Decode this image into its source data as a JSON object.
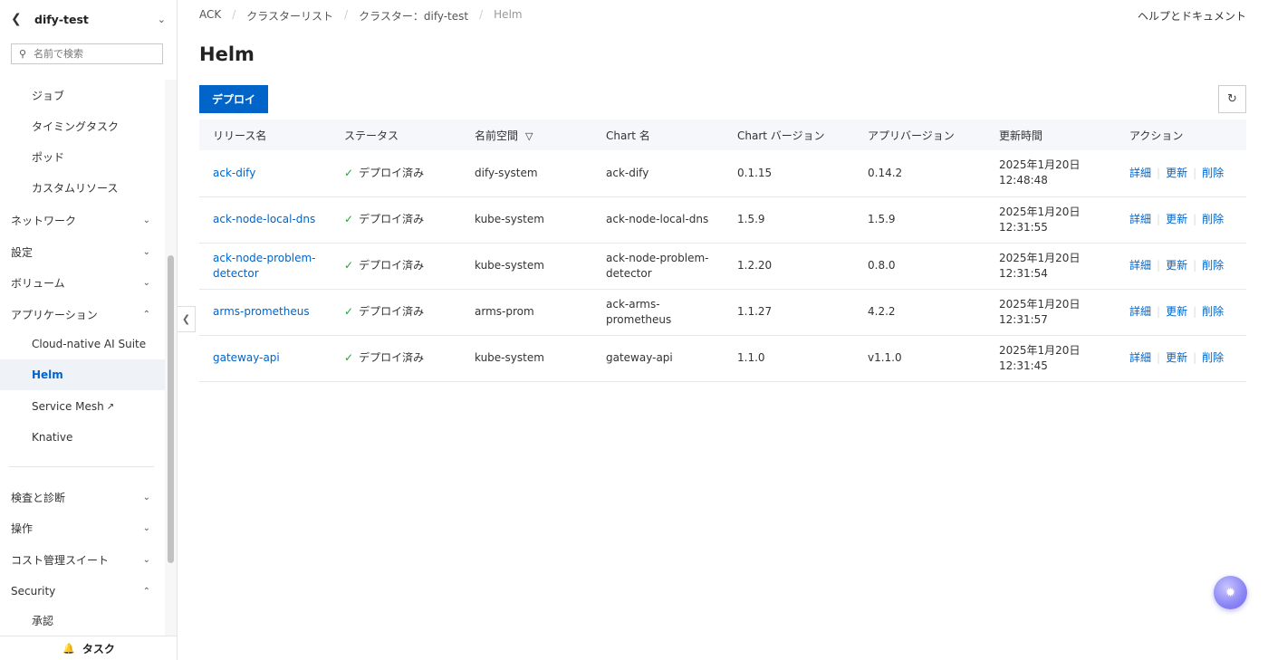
{
  "sidebar": {
    "title": "dify-test",
    "search_placeholder": "名前で検索",
    "items": [
      {
        "label": "ジョブ"
      },
      {
        "label": "タイミングタスク"
      },
      {
        "label": "ポッド"
      },
      {
        "label": "カスタムリソース"
      },
      {
        "label": "ネットワーク"
      },
      {
        "label": "設定"
      },
      {
        "label": "ボリューム"
      },
      {
        "label": "アプリケーション"
      },
      {
        "label": "Cloud-native AI Suite"
      },
      {
        "label": "Helm"
      },
      {
        "label": "Service Mesh"
      },
      {
        "label": "Knative"
      },
      {
        "label": "検査と診断"
      },
      {
        "label": "操作"
      },
      {
        "label": "コスト管理スイート"
      },
      {
        "label": "Security"
      },
      {
        "label": "承認"
      }
    ],
    "footer_label": "タスク"
  },
  "breadcrumb": [
    "ACK",
    "クラスターリスト",
    "クラスター：dify-test",
    "Helm"
  ],
  "help_link": "ヘルプとドキュメント",
  "page_title": "Helm",
  "deploy_button": "デプロイ",
  "table": {
    "columns": [
      "リリース名",
      "ステータス",
      "名前空間",
      "Chart 名",
      "Chart バージョン",
      "アプリバージョン",
      "更新時間",
      "アクション"
    ],
    "rows": [
      {
        "name": "ack-dify",
        "status": "デプロイ済み",
        "namespace": "dify-system",
        "chart": "ack-dify",
        "chart_version": "0.1.15",
        "app_version": "0.14.2",
        "updated_date": "2025年1月20日",
        "updated_time": "12:48:48"
      },
      {
        "name": "ack-node-local-dns",
        "status": "デプロイ済み",
        "namespace": "kube-system",
        "chart": "ack-node-local-dns",
        "chart_version": "1.5.9",
        "app_version": "1.5.9",
        "updated_date": "2025年1月20日",
        "updated_time": "12:31:55"
      },
      {
        "name": "ack-node-problem-detector",
        "status": "デプロイ済み",
        "namespace": "kube-system",
        "chart": "ack-node-problem-detector",
        "chart_version": "1.2.20",
        "app_version": "0.8.0",
        "updated_date": "2025年1月20日",
        "updated_time": "12:31:54"
      },
      {
        "name": "arms-prometheus",
        "status": "デプロイ済み",
        "namespace": "arms-prom",
        "chart": "ack-arms-prometheus",
        "chart_version": "1.1.27",
        "app_version": "4.2.2",
        "updated_date": "2025年1月20日",
        "updated_time": "12:31:57"
      },
      {
        "name": "gateway-api",
        "status": "デプロイ済み",
        "namespace": "kube-system",
        "chart": "gateway-api",
        "chart_version": "1.1.0",
        "app_version": "v1.1.0",
        "updated_date": "2025年1月20日",
        "updated_time": "12:31:45"
      }
    ],
    "actions": [
      "詳細",
      "更新",
      "削除"
    ]
  },
  "colors": {
    "accent": "#0064c8",
    "success": "#20a53a"
  }
}
